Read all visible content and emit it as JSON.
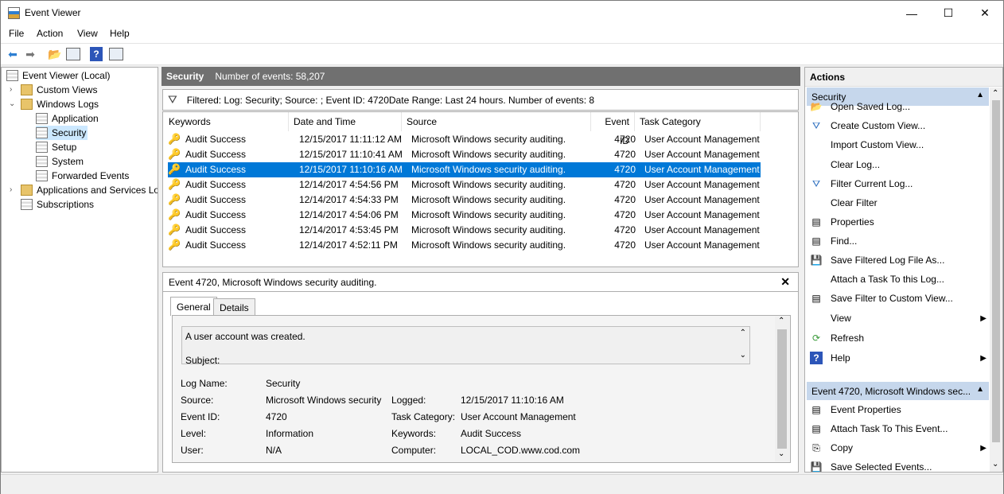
{
  "window": {
    "title": "Event Viewer",
    "minimize": "—",
    "maximize": "☐",
    "close": "✕"
  },
  "menu": [
    "File",
    "Action",
    "View",
    "Help"
  ],
  "tree": {
    "root": "Event Viewer (Local)",
    "custom_views": "Custom Views",
    "windows_logs": "Windows Logs",
    "application": "Application",
    "security": "Security",
    "setup": "Setup",
    "system": "System",
    "forwarded": "Forwarded Events",
    "app_services": "Applications and Services Lo",
    "subscriptions": "Subscriptions"
  },
  "log": {
    "name": "Security",
    "count_text": "Number of events: 58,207"
  },
  "filter_text": "Filtered: Log: Security; Source: ; Event ID: 4720Date Range: Last 24 hours. Number of events: 8",
  "columns": [
    "Keywords",
    "Date and Time",
    "Source",
    "Event ID",
    "Task Category"
  ],
  "rows": [
    {
      "keywords": "Audit Success",
      "date": "12/15/2017 11:11:12 AM",
      "source": "Microsoft Windows security auditing.",
      "id": "4720",
      "task": "User Account Management"
    },
    {
      "keywords": "Audit Success",
      "date": "12/15/2017 11:10:41 AM",
      "source": "Microsoft Windows security auditing.",
      "id": "4720",
      "task": "User Account Management"
    },
    {
      "keywords": "Audit Success",
      "date": "12/15/2017 11:10:16 AM",
      "source": "Microsoft Windows security auditing.",
      "id": "4720",
      "task": "User Account Management"
    },
    {
      "keywords": "Audit Success",
      "date": "12/14/2017 4:54:56 PM",
      "source": "Microsoft Windows security auditing.",
      "id": "4720",
      "task": "User Account Management"
    },
    {
      "keywords": "Audit Success",
      "date": "12/14/2017 4:54:33 PM",
      "source": "Microsoft Windows security auditing.",
      "id": "4720",
      "task": "User Account Management"
    },
    {
      "keywords": "Audit Success",
      "date": "12/14/2017 4:54:06 PM",
      "source": "Microsoft Windows security auditing.",
      "id": "4720",
      "task": "User Account Management"
    },
    {
      "keywords": "Audit Success",
      "date": "12/14/2017 4:53:45 PM",
      "source": "Microsoft Windows security auditing.",
      "id": "4720",
      "task": "User Account Management"
    },
    {
      "keywords": "Audit Success",
      "date": "12/14/2017 4:52:11 PM",
      "source": "Microsoft Windows security auditing.",
      "id": "4720",
      "task": "User Account Management"
    }
  ],
  "detail": {
    "header": "Event 4720, Microsoft Windows security auditing.",
    "tabs": [
      "General",
      "Details"
    ],
    "message_line1": "A user account was created.",
    "message_line2": "Subject:",
    "log_name_label": "Log Name:",
    "log_name": "Security",
    "source_label": "Source:",
    "source": "Microsoft Windows security",
    "logged_label": "Logged:",
    "logged": "12/15/2017 11:10:16 AM",
    "event_id_label": "Event ID:",
    "event_id": "4720",
    "task_label": "Task Category:",
    "task": "User Account Management",
    "level_label": "Level:",
    "level": "Information",
    "keywords_label": "Keywords:",
    "keywords": "Audit Success",
    "user_label": "User:",
    "user": "N/A",
    "computer_label": "Computer:",
    "computer": "LOCAL_COD.www.cod.com"
  },
  "actions": {
    "title": "Actions",
    "group1": "Security",
    "items1": [
      "Open Saved Log...",
      "Create Custom View...",
      "Import Custom View...",
      "Clear Log...",
      "Filter Current Log...",
      "Clear Filter",
      "Properties",
      "Find...",
      "Save Filtered Log File As...",
      "Attach a Task To this Log...",
      "Save Filter to Custom View...",
      "View",
      "Refresh",
      "Help"
    ],
    "group2": "Event 4720, Microsoft Windows sec...",
    "items2": [
      "Event Properties",
      "Attach Task To This Event...",
      "Copy",
      "Save Selected Events..."
    ]
  },
  "colors": {
    "selection": "#0078d7",
    "header_bar": "#707070",
    "action_group": "#c6d7ec"
  }
}
